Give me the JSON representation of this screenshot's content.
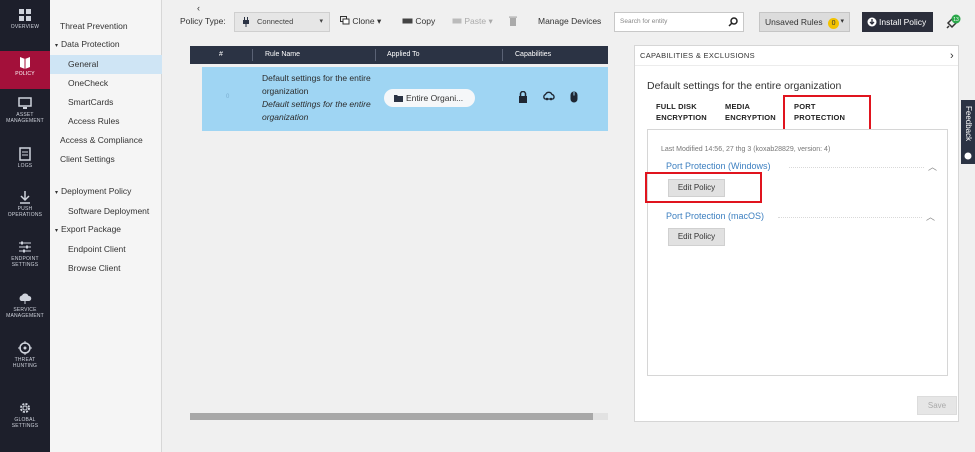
{
  "nav": {
    "items": [
      {
        "label": "OVERVIEW",
        "icon": "dashboard-icon"
      },
      {
        "label": "POLICY",
        "icon": "book-icon",
        "active": true
      },
      {
        "label": "ASSET MANAGEMENT",
        "icon": "monitor-icon"
      },
      {
        "label": "LOGS",
        "icon": "document-icon"
      },
      {
        "label": "PUSH OPERATIONS",
        "icon": "download-icon"
      },
      {
        "label": "ENDPOINT SETTINGS",
        "icon": "sliders-icon"
      },
      {
        "label": "SERVICE MANAGEMENT",
        "icon": "cloud-icon"
      },
      {
        "label": "THREAT HUNTING",
        "icon": "crosshair-icon"
      },
      {
        "label": "GLOBAL SETTINGS",
        "icon": "gear-icon"
      }
    ]
  },
  "sidebar": {
    "items": [
      {
        "label": "Threat Prevention"
      },
      {
        "label": "Data Protection",
        "expander": "▾"
      },
      {
        "label": "General"
      },
      {
        "label": "OneCheck"
      },
      {
        "label": "SmartCards"
      },
      {
        "label": "Access Rules"
      },
      {
        "label": "Access & Compliance"
      },
      {
        "label": "Client Settings"
      },
      {
        "label": "Deployment Policy",
        "expander": "▾"
      },
      {
        "label": "Software Deployment"
      },
      {
        "label": "Export Package",
        "expander": "▾"
      },
      {
        "label": "Endpoint Client"
      },
      {
        "label": "Browse Client"
      }
    ]
  },
  "toolbar": {
    "policy_type_label": "Policy Type:",
    "policy_type_value": "Connected",
    "clone_label": "Clone",
    "copy_label": "Copy",
    "paste_label": "Paste",
    "manage_devices_label": "Manage Devices",
    "search_placeholder": "Search for entity",
    "unsaved_label": "Unsaved Rules",
    "unsaved_count": "0",
    "install_label": "Install Policy",
    "status_count": "13"
  },
  "table": {
    "headers": [
      "#",
      "Rule Name",
      "Applied To",
      "Capabilities"
    ],
    "row": {
      "num": "0",
      "name": "Default settings for the entire organization",
      "comment": "Default settings for the entire organization",
      "applied_to": "Entire Organi...",
      "capabilities": [
        "lock-icon",
        "cloud-network-icon",
        "mouse-icon"
      ]
    }
  },
  "panel": {
    "header": "CAPABILITIES & EXCLUSIONS",
    "title": "Default settings for the entire organization",
    "tabs": [
      {
        "line1": "FULL DISK",
        "line2": "ENCRYPTION"
      },
      {
        "line1": "MEDIA",
        "line2": "ENCRYPTION"
      },
      {
        "line1": "PORT",
        "line2": "PROTECTION",
        "active": true
      }
    ],
    "last_modified": "Last Modified 14:56, 27 thg 3 (koxab28829, version: 4)",
    "sections": [
      {
        "title": "Port Protection (Windows)",
        "button": "Edit Policy"
      },
      {
        "title": "Port Protection (macOS)",
        "button": "Edit Policy"
      }
    ],
    "save_label": "Save"
  },
  "feedback_label": "Feedback",
  "colors": {
    "nav_bg": "#1d1f2b",
    "nav_active": "#a3103a",
    "row_selected": "#9fd5f3",
    "link_blue": "#3c7fc0",
    "highlight_red": "#e0141e",
    "badge_yellow": "#f2c200"
  }
}
